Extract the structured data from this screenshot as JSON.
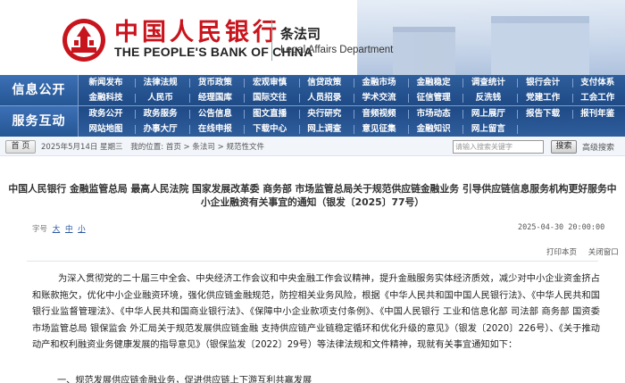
{
  "header": {
    "bank_name_cn": "中国人民银行",
    "bank_name_en": "THE PEOPLE'S BANK OF CHINA",
    "dept_cn": "条法司",
    "dept_en": "Legal Affairs Department",
    "logo_icon": "pboc-logo-icon",
    "logo_color": "#c8141c"
  },
  "nav": {
    "row1_title": "信息公开",
    "row2_title": "服务互动",
    "row1_links": [
      "新闻发布",
      "法律法规",
      "货币政策",
      "宏观审慎",
      "信贷政策",
      "金融市场",
      "金融稳定",
      "调查统计",
      "银行会计",
      "支付体系",
      "金融科技",
      "人民币",
      "经理国库",
      "国际交往",
      "人员招录",
      "学术交流",
      "征信管理",
      "反洗钱",
      "党建工作",
      "工会工作"
    ],
    "row2_links": [
      "政务公开",
      "政务服务",
      "公告信息",
      "图文直播",
      "央行研究",
      "音频视频",
      "市场动态",
      "网上展厅",
      "报告下载",
      "报刊年鉴",
      "网站地图",
      "办事大厅",
      "在线申报",
      "下载中心",
      "网上调查",
      "意见征集",
      "金融知识",
      "网上留言"
    ],
    "bg_color": "#1e4a86"
  },
  "crumb": {
    "home_button": "首 页",
    "date_text": "2025年5月14日 星期三",
    "location_prefix": "我的位置:",
    "path": [
      "首页",
      "条法司",
      "规范性文件"
    ],
    "path_sep": " > ",
    "search_placeholder": "请输入搜索关键字",
    "search_button": "搜索",
    "advanced_search": "高级搜索"
  },
  "article": {
    "title": "中国人民银行 金融监管总局 最高人民法院 国家发展改革委 商务部 市场监管总局关于规范供应链金融业务 引导供应链信息服务机构更好服务中小企业融资有关事宜的通知（银发〔2025〕77号）",
    "font_size_label": "字号",
    "font_sizes": [
      "大",
      "中",
      "小"
    ],
    "date": "2025-04-30 20:00:00",
    "print_label": "打印本页",
    "close_label": "关闭窗口",
    "body": "为深入贯彻党的二十届三中全会、中央经济工作会议和中央金融工作会议精神，提升金融服务实体经济质效，减少对中小企业资金挤占和账款拖欠，优化中小企业融资环境，强化供应链金融规范，防控相关业务风险，根据《中华人民共和国中国人民银行法》、《中华人民共和国银行业监督管理法》、《中华人民共和国商业银行法》、《保障中小企业款项支付条例》、《中国人民银行 工业和信息化部 司法部 商务部 国资委 市场监管总局 银保监会 外汇局关于规范发展供应链金融 支持供应链产业链稳定循环和优化升级的意见》（银发〔2020〕226号）、《关于推动动产和权利融资业务健康发展的指导意见》（银保监发〔2022〕29号）等法律法规和文件精神，现就有关事宜通知如下：",
    "first_heading": "一、规范发展供应链金融业务，促进供应链上下游互利共赢发展"
  }
}
